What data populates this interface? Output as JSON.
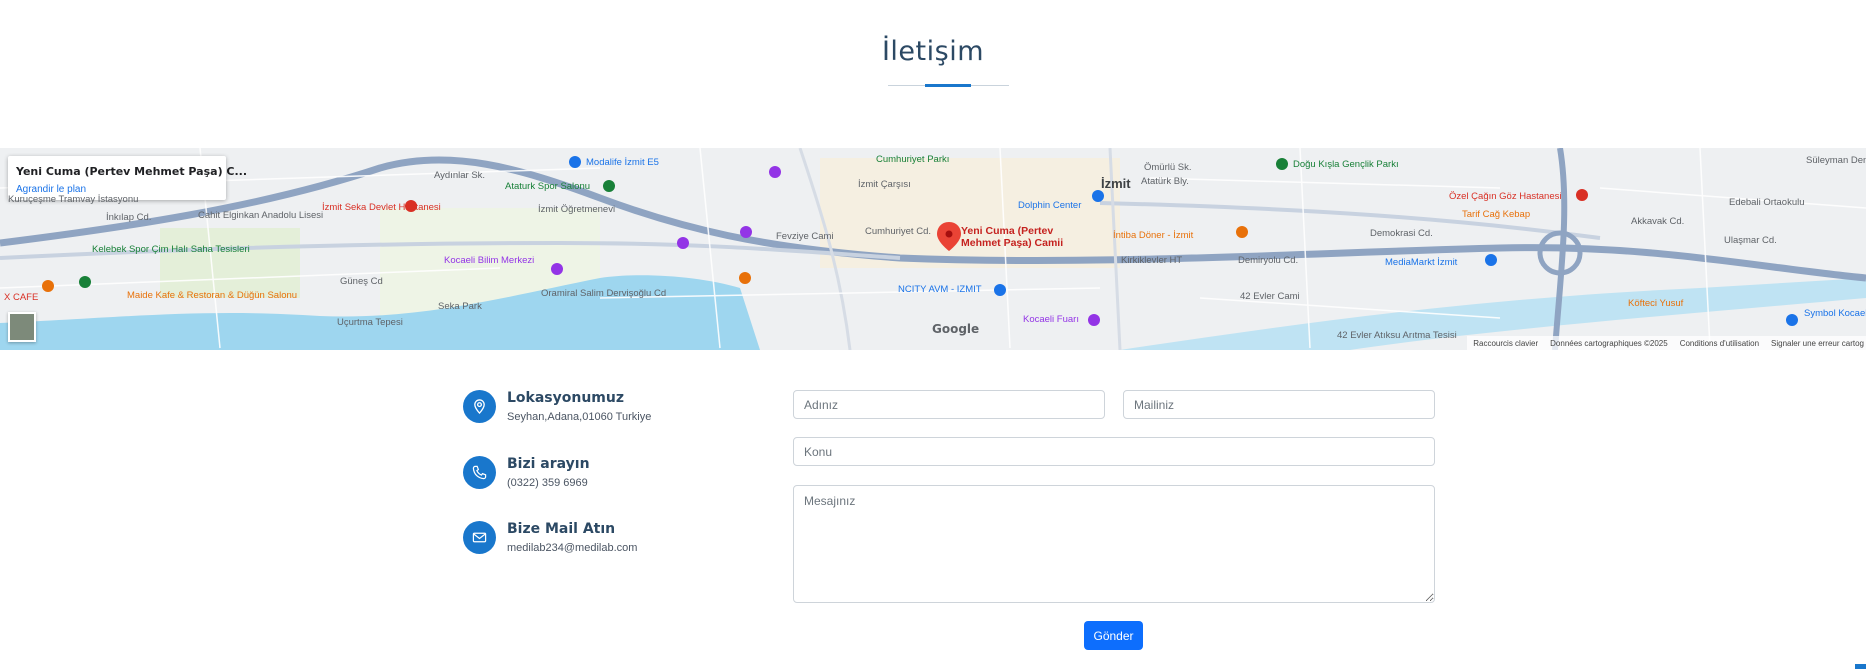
{
  "section": {
    "title": "İletişim"
  },
  "map": {
    "place_name": "Yeni Cuma (Pertev Mehmet Paşa) C...",
    "enlarge_link": "Agrandir le plan",
    "pin_label_line1": "Yeni Cuma (Pertev",
    "pin_label_line2": "Mehmet Paşa) Camii",
    "logo_text": "Google",
    "footer": [
      "Raccourcis clavier",
      "Données cartographiques ©2025",
      "Conditions d'utilisation",
      "Signaler une erreur cartog"
    ],
    "labels": [
      "İzmit",
      "Modalife İzmit E5",
      "Cumhuriyet Parkı",
      "İzmit Çarşısı",
      "Atatürk Bly.",
      "Doğu Kışla Gençlik Parkı",
      "Süleyman Demirel Kültür Merkezi",
      "Kuruçeşme Tramvay İstasyonu",
      "Cahit Elginkan Anadolu Lisesi",
      "İzmit Seka Devlet Hastanesi",
      "Ataturk Spor Salonu",
      "İzmit Öğretmenevi",
      "Dolphin Center",
      "Özel Çağın Göz Hastanesi",
      "Tarif Cağ Kebap",
      "Edebali Ortaokulu",
      "Kelebek Spor Çim Halı Saha Tesisleri",
      "Kocaeli Bilim Merkezi",
      "Fevziye Cami",
      "İntiba Döner - İzmit",
      "Demokrasi Cd.",
      "MediaMarkt İzmit",
      "Ulaşmar Cd.",
      "X CAFE",
      "Maide Kafe & Restoran & Düğün Salonu",
      "Seka Park",
      "Oramiral Salim Dervişoğlu Cd",
      "NCITY AVM - IZMIT",
      "42 Evler Cami",
      "Köfteci Yusuf",
      "Uçurtma Tepesi",
      "Kocaeli Fuarı",
      "42 Evler Atıksu Arıtma Tesisi",
      "Symbol Kocaeli Alışveriş Merkezi",
      "Cumhuriyet Cd.",
      "Akkavak Cd.",
      "Kirkiklevler HT",
      "Demiryolu Cd.",
      "Güneş Cd",
      "İnkılap Cd.",
      "Aydınlar Sk.",
      "Ömürlü Sk."
    ]
  },
  "contact": {
    "location": {
      "title": "Lokasyonumuz",
      "text": "Seyhan,Adana,01060 Turkiye"
    },
    "phone": {
      "title": "Bizi arayın",
      "text": "(0322) 359 6969"
    },
    "mail": {
      "title": "Bize Mail Atın",
      "text": "medilab234@medilab.com"
    }
  },
  "form": {
    "name_placeholder": "Adınız",
    "email_placeholder": "Mailiniz",
    "subject_placeholder": "Konu",
    "message_placeholder": "Mesajınız",
    "submit_label": "Gönder"
  },
  "colors": {
    "accent": "#1977cc",
    "heading": "#2c4964",
    "button": "#0d6efd",
    "water": "#9ed6ef",
    "road": "#8fa4c2"
  }
}
